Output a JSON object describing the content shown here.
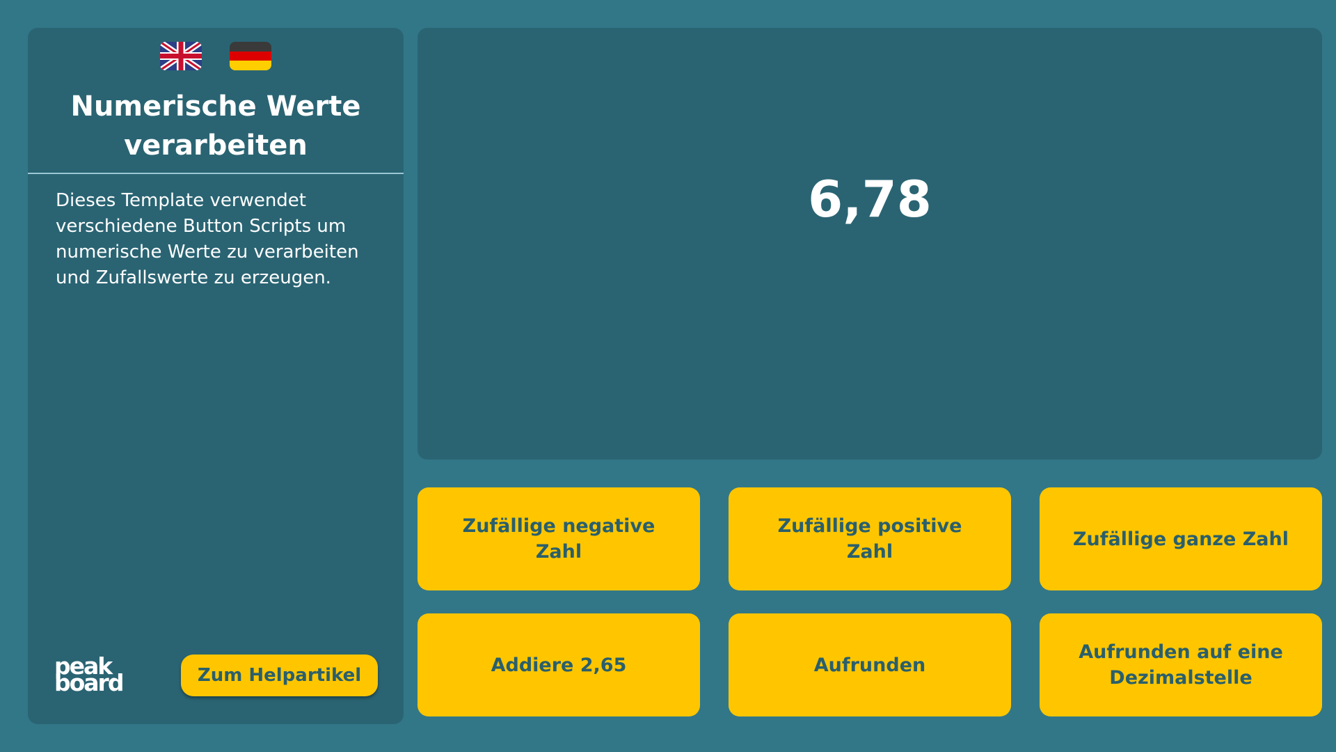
{
  "sidebar": {
    "flags": [
      {
        "name": "uk-flag-icon",
        "colors": [
          "#2b3f86",
          "#ffffff",
          "#c8102e"
        ]
      },
      {
        "name": "germany-flag-icon",
        "colors": [
          "#3a3a3a",
          "#dd0000",
          "#ffce00"
        ]
      }
    ],
    "title_line1": "Numerische Werte",
    "title_line2": "verarbeiten",
    "description": "Dieses Template verwendet verschiedene Button Scripts um numerische Werte zu verarbeiten und Zufallswerte zu erzeugen.",
    "logo_line1": "peak",
    "logo_line2": "board",
    "help_button": "Zum Helpartikel"
  },
  "display": {
    "value": "6,78"
  },
  "buttons": {
    "random_negative": "Zufällige negative Zahl",
    "random_positive": "Zufällige positive Zahl",
    "random_integer": "Zufällige ganze Zahl",
    "add": "Addiere 2,65",
    "round_up": "Aufrunden",
    "round_up_decimal": "Aufrunden auf eine Dezimalstelle"
  },
  "colors": {
    "background": "#327787",
    "panel": "#2a6473",
    "accent": "#ffc600",
    "button_text": "#2a5f6c"
  }
}
